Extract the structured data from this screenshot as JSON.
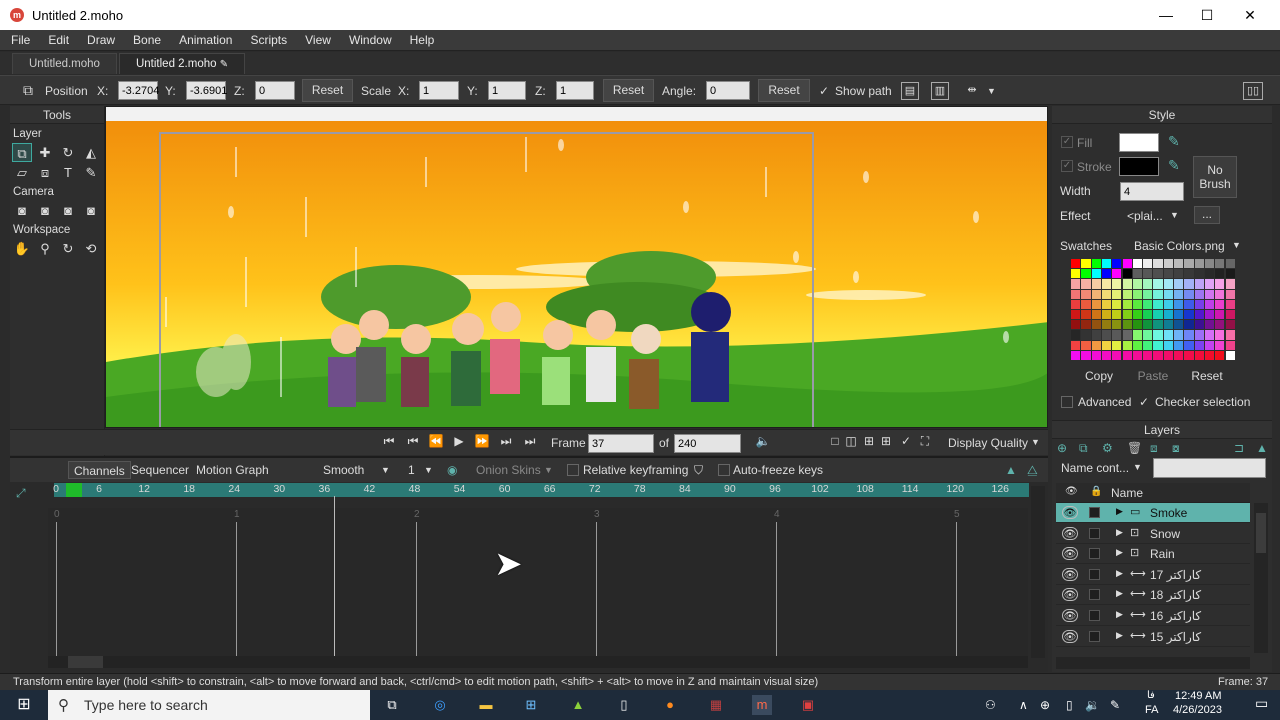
{
  "window": {
    "title": "Untitled 2.moho",
    "app_icon": "moho-icon",
    "minimize": "—",
    "maximize": "☐",
    "close": "✕"
  },
  "menu": [
    "File",
    "Edit",
    "Draw",
    "Bone",
    "Animation",
    "Scripts",
    "View",
    "Window",
    "Help"
  ],
  "doc_tabs": [
    {
      "label": "Untitled.moho"
    },
    {
      "label": "Untitled 2.moho",
      "active": true
    }
  ],
  "toolbar": {
    "position_label": "Position",
    "x_label": "X:",
    "x_value": "-3.2704",
    "y_label": "Y:",
    "y_value": "-3.6901",
    "z_label": "Z:",
    "z_value": "0",
    "reset": "Reset",
    "scale_label": "Scale",
    "sx_label": "X:",
    "sx_value": "1",
    "sy_label": "Y:",
    "sy_value": "1",
    "sz_label": "Z:",
    "sz_value": "1",
    "angle_label": "Angle:",
    "angle_value": "0",
    "show_path": "Show path",
    "show_path_checked": true
  },
  "tools": {
    "header": "Tools",
    "sections": [
      {
        "label": "Layer",
        "rows": [
          [
            "transform-layer-icon",
            "translate-icon",
            "rotate-icon",
            "scale-icon"
          ],
          [
            "shear-icon",
            "dual-tool-icon",
            "text-icon",
            "eyedropper-icon"
          ]
        ]
      },
      {
        "label": "Camera",
        "rows": [
          [
            "camera-track-icon",
            "camera-zoom-icon",
            "camera-roll-icon",
            "camera-pan-icon"
          ]
        ]
      },
      {
        "label": "Workspace",
        "rows": [
          [
            "hand-icon",
            "magnifier-icon",
            "rotate-workspace-icon",
            "orbit-icon"
          ]
        ]
      }
    ]
  },
  "playbar": {
    "frame_label": "Frame",
    "frame_value": "37",
    "of_label": "of",
    "total_frames": "240",
    "display_quality": "Display Quality"
  },
  "timeline": {
    "tabs": [
      "Channels",
      "Sequencer",
      "Motion Graph"
    ],
    "interp": "Smooth",
    "interp_count": "1",
    "onion_skins": "Onion Skins",
    "relative_keyframing": "Relative keyframing",
    "auto_freeze": "Auto-freeze keys",
    "ruler_ticks": [
      "0",
      "6",
      "12",
      "18",
      "24",
      "30",
      "36",
      "42",
      "48",
      "54",
      "60",
      "66",
      "72",
      "78",
      "84",
      "90",
      "96",
      "102",
      "108",
      "114",
      "120",
      "126"
    ],
    "second_labels": [
      "0",
      "1",
      "2",
      "3",
      "4",
      "5"
    ],
    "current_frame": 37
  },
  "style": {
    "header": "Style",
    "fill_label": "Fill",
    "stroke_label": "Stroke",
    "fill_color": "#ffffff",
    "stroke_color": "#000000",
    "no_brush": [
      "No",
      "Brush"
    ],
    "width_label": "Width",
    "width_value": "4",
    "effect_label": "Effect",
    "effect_value": "<plai...",
    "effect_more": "...",
    "swatches_label": "Swatches",
    "swatches_value": "Basic Colors.png",
    "copy": "Copy",
    "paste": "Paste",
    "reset": "Reset",
    "advanced": "Advanced",
    "checker_selection": "Checker selection"
  },
  "layers": {
    "header": "Layers",
    "filter_label": "Name cont...",
    "name_col": "Name",
    "items": [
      {
        "name": "Smoke",
        "icon": "folder-icon",
        "selected": true
      },
      {
        "name": "Snow",
        "icon": "particle-layer-icon"
      },
      {
        "name": "Rain",
        "icon": "particle-layer-icon"
      },
      {
        "name": "کاراکتر 17",
        "icon": "bone-layer-icon"
      },
      {
        "name": "کاراکتر 18",
        "icon": "bone-layer-icon"
      },
      {
        "name": "کاراکتر 16",
        "icon": "bone-layer-icon"
      },
      {
        "name": "کاراکتر 15",
        "icon": "bone-layer-icon"
      }
    ]
  },
  "status": {
    "message": "Transform entire layer (hold <shift> to constrain, <alt> to move forward and back, <ctrl/cmd> to edit motion path, <shift> + <alt> to move in Z and maintain visual size)",
    "frame": "Frame: 37"
  },
  "taskbar": {
    "search_placeholder": "Type here to search",
    "time": "12:49 AM",
    "date": "4/26/2023",
    "lang": "FA",
    "lang_top": "فا"
  },
  "colors": {
    "accent": "#5fb3ac",
    "ruler": "#2b7a76",
    "sky_top": "#f08a0a",
    "sky_mid": "#ffd21f",
    "grass": "#3c9a1e"
  }
}
